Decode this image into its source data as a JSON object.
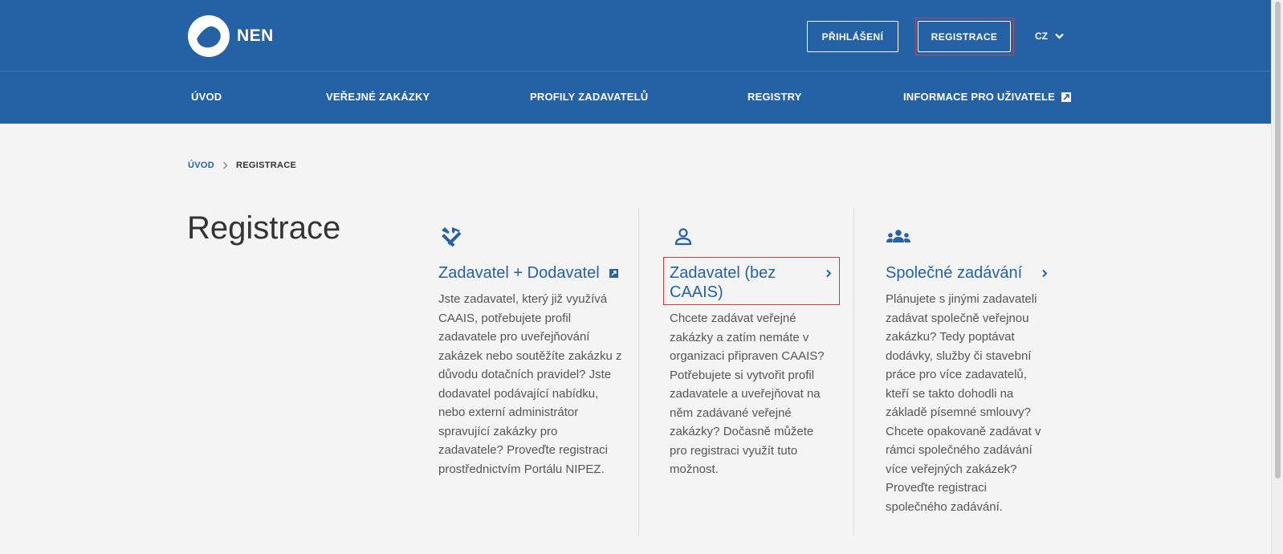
{
  "header": {
    "logo_text": "NEN",
    "login_label": "PŘIHLÁŠENÍ",
    "register_label": "REGISTRACE",
    "language": "CZ"
  },
  "nav": {
    "items": [
      {
        "label": "ÚVOD"
      },
      {
        "label": "VEŘEJNÉ ZAKÁZKY"
      },
      {
        "label": "PROFILY ZADAVATELŮ"
      },
      {
        "label": "REGISTRY"
      },
      {
        "label": "INFORMACE PRO UŽIVATELE"
      }
    ]
  },
  "breadcrumb": {
    "home": "ÚVOD",
    "separator": ">",
    "current": "REGISTRACE"
  },
  "page_title": "Registrace",
  "cards": [
    {
      "icon": "tools-icon",
      "title": "Zadavatel + Dodavatel",
      "text": "Jste zadavatel, který již využívá CAAIS, potřebujete profil zadavatele pro uveřejňování zakázek nebo soutěžíte zakázku z důvodu dotačních pravidel? Jste dodavatel podávající nabídku, nebo externí administrátor spravující zakázky pro zadavatele? Proveďte registraci prostřednictvím Portálu NIPEZ."
    },
    {
      "icon": "user-icon",
      "title": "Zadavatel (bez CAAIS)",
      "text": "Chcete zadávat veřejné zakázky a zatím nemáte v organizaci připraven CAAIS? Potřebujete si vytvořit profil zadavatele a uveřejňovat na něm zadávané veřejné zakázky? Dočasně můžete pro registraci využít tuto možnost."
    },
    {
      "icon": "group-icon",
      "title": "Společné zadávání",
      "text": "Plánujete s jinými zadavateli zadávat společně veřejnou zakázku? Tedy poptávat dodávky, služby či stavební práce pro více zadavatelů, kteří se takto dohodli na základě písemné smlouvy? Chcete opakovaně zadávat v rámci společného zadávání více veřejných zakázek? Proveďte registraci společného zadávání."
    }
  ],
  "colors": {
    "brand_blue": "#2462a5",
    "background": "#f4f4f4"
  }
}
